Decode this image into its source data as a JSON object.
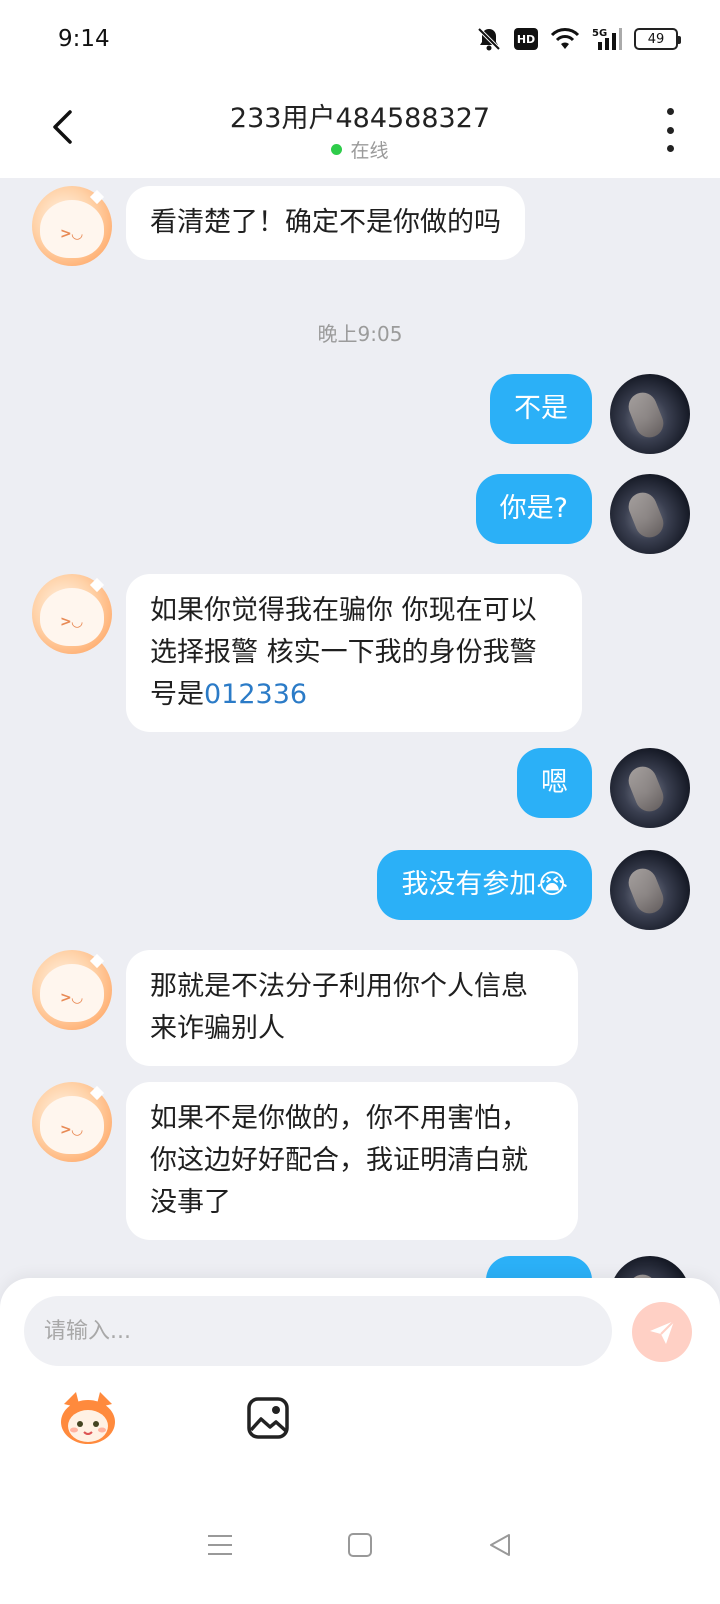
{
  "status_bar": {
    "time": "9:14",
    "battery": "49",
    "icons": [
      "mute-bell-icon",
      "hd-icon",
      "wifi-icon",
      "5g-signal-icon",
      "battery-icon"
    ],
    "hd_label": "HD",
    "network_label": "5G"
  },
  "header": {
    "title": "233用户484588327",
    "status": "在线",
    "status_color": "#2ecc4a"
  },
  "chat": {
    "timestamp": "晚上9:05",
    "messages": [
      {
        "side": "left",
        "text": "看清楚了！确定不是你做的吗"
      },
      {
        "side": "right",
        "text": "不是"
      },
      {
        "side": "right",
        "text": "你是?"
      },
      {
        "side": "left",
        "text_before_link": "如果你觉得我在骗你 你现在可以选择报警 核实一下我的身份我警号是",
        "link": "012336"
      },
      {
        "side": "right",
        "text": "嗯"
      },
      {
        "side": "right",
        "text": "我没有参加😭"
      },
      {
        "side": "left",
        "text": "那就是不法分子利用你个人信息来诈骗别人"
      },
      {
        "side": "left",
        "text": "如果不是你做的，你不用害怕，你这边好好配合，我证明清白就没事了"
      }
    ]
  },
  "composer": {
    "placeholder": "请输入...",
    "value": ""
  },
  "colors": {
    "outgoing_bubble": "#2bb0f7",
    "incoming_bubble": "#ffffff",
    "link": "#2b7bc7",
    "send_button": "#ffd0c5"
  }
}
